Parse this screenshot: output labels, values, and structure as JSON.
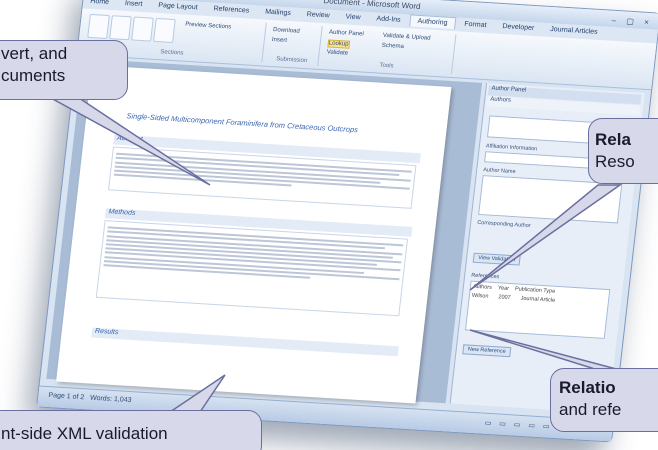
{
  "app": {
    "title": "Document - Microsoft Word",
    "window_controls": "– ▢ ×",
    "quick_access": "▣ ↶ ↷ ▾",
    "ribbon_tabs": [
      "Home",
      "Insert",
      "Page Layout",
      "References",
      "Mailings",
      "Review",
      "View",
      "Add-Ins",
      "Authoring",
      "Format",
      "Developer",
      "Journal Articles"
    ],
    "active_tab": "Authoring",
    "ribbon_groups": [
      "Sections",
      "Submission",
      "Tools"
    ],
    "ribbon_buttons": [
      "Preview Sections",
      "Download",
      "Insert",
      "Author Panel",
      "Lookup",
      "Validate",
      "Validate & Upload",
      "Schema"
    ],
    "doc_title": "Single-Sided Multicomponent Foraminifera from Cretaceous Outcrops",
    "sections": [
      "Abstract",
      "Methods",
      "Results"
    ],
    "side_panel": {
      "header": "Author Panel",
      "tab": "Authors",
      "fields": [
        "Affiliation Information",
        "Author Name",
        "Corresponding Author"
      ],
      "validate_button": "View Validation",
      "references_label": "References",
      "ref_columns": [
        "Authors",
        "Year",
        "Publication Type"
      ],
      "ref_row": [
        "Wilson",
        "2007",
        "Journal Article"
      ],
      "new_reference_button": "New Reference"
    },
    "status": {
      "page": "Page 1 of 2",
      "words": "Words: 1,043",
      "view_icons": "▭ ▭ ▭ ▭ ▭"
    }
  },
  "callouts": {
    "top_left_line1": "vert,  and",
    "top_left_line2": "cuments",
    "right_top_bold": "Rela",
    "right_top_line2": "Reso",
    "right_bottom_bold": "Relatio",
    "right_bottom_line2": "and refe",
    "bottom_left": "nt-side XML validation"
  }
}
